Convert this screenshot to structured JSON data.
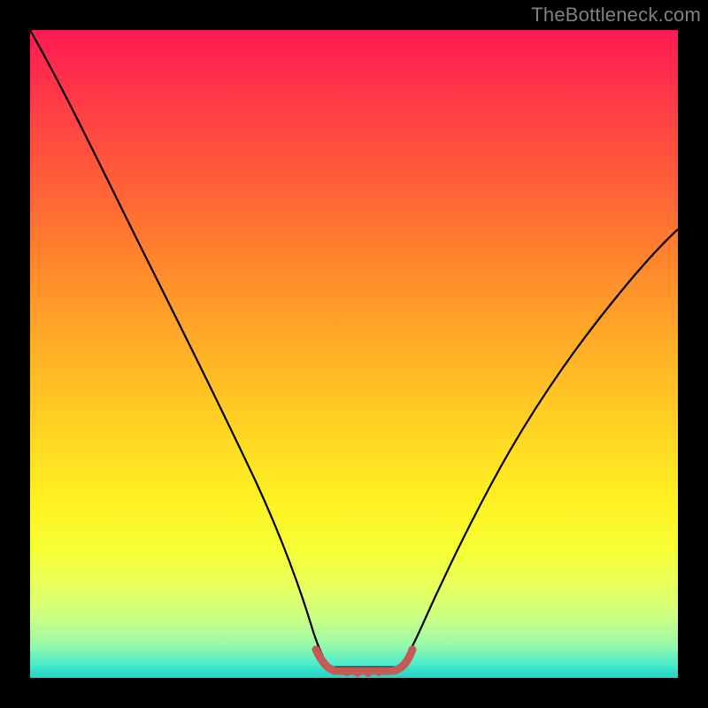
{
  "watermark": "TheBottleneck.com",
  "chart_data": {
    "type": "line",
    "title": "",
    "xlabel": "",
    "ylabel": "",
    "xlim": [
      0,
      100
    ],
    "ylim": [
      0,
      100
    ],
    "x": [
      0,
      5,
      10,
      15,
      20,
      25,
      30,
      35,
      40,
      43,
      45,
      47,
      49,
      51,
      53,
      55,
      58,
      62,
      67,
      72,
      78,
      85,
      92,
      100
    ],
    "values": [
      100,
      92,
      82,
      72,
      61,
      50,
      39,
      28,
      16,
      8,
      4,
      2,
      1,
      1,
      1,
      2,
      4,
      8,
      14,
      21,
      30,
      40,
      51,
      63
    ],
    "marker_region": {
      "x": [
        43,
        45,
        47,
        49,
        51,
        53,
        55,
        57
      ],
      "values": [
        4,
        2,
        1,
        0.5,
        0.5,
        1,
        2,
        4
      ]
    },
    "colors": {
      "curve": "#000000",
      "marker": "#c65a57",
      "gradient_top": "#ff1a52",
      "gradient_bottom": "#22d0c4"
    }
  }
}
